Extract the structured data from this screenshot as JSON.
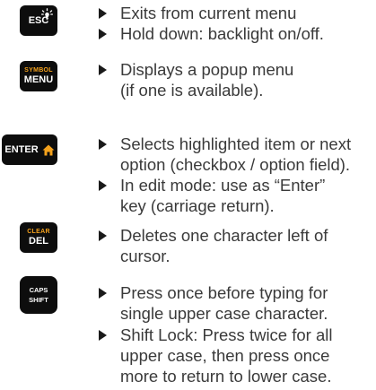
{
  "keys": {
    "esc": {
      "label": "ESC",
      "icon": "backlight-icon"
    },
    "menu": {
      "sub": "SYMBOL",
      "label": "MENU"
    },
    "enter": {
      "label": "ENTER",
      "icon": "home-icon"
    },
    "del": {
      "sub": "CLEAR",
      "label": "DEL"
    },
    "shift": {
      "line1": "CAPS",
      "line2": "SHIFT"
    }
  },
  "descriptions": {
    "esc_1": "Exits from current menu",
    "esc_2": "Hold down: backlight on/off.",
    "menu_1a": "Displays a popup menu",
    "menu_1b": "(if one is available).",
    "enter_1a": "Selects highlighted item or next",
    "enter_1b": "option (checkbox / option field).",
    "enter_2a": "In edit mode: use as “Enter”",
    "enter_2b": "key (carriage return).",
    "del_1a": "Deletes one character left of",
    "del_1b": "cursor.",
    "shift_1a": "Press once before typing for",
    "shift_1b": "single upper case character.",
    "shift_2a": "Shift Lock: Press twice for all",
    "shift_2b": "upper case, then press once",
    "shift_2c": "more to return to lower case."
  },
  "colors": {
    "key_bg": "#0d0d0d",
    "key_text": "#ffffff",
    "key_accent": "#f5a21c",
    "body_text": "#3a3a3a"
  }
}
